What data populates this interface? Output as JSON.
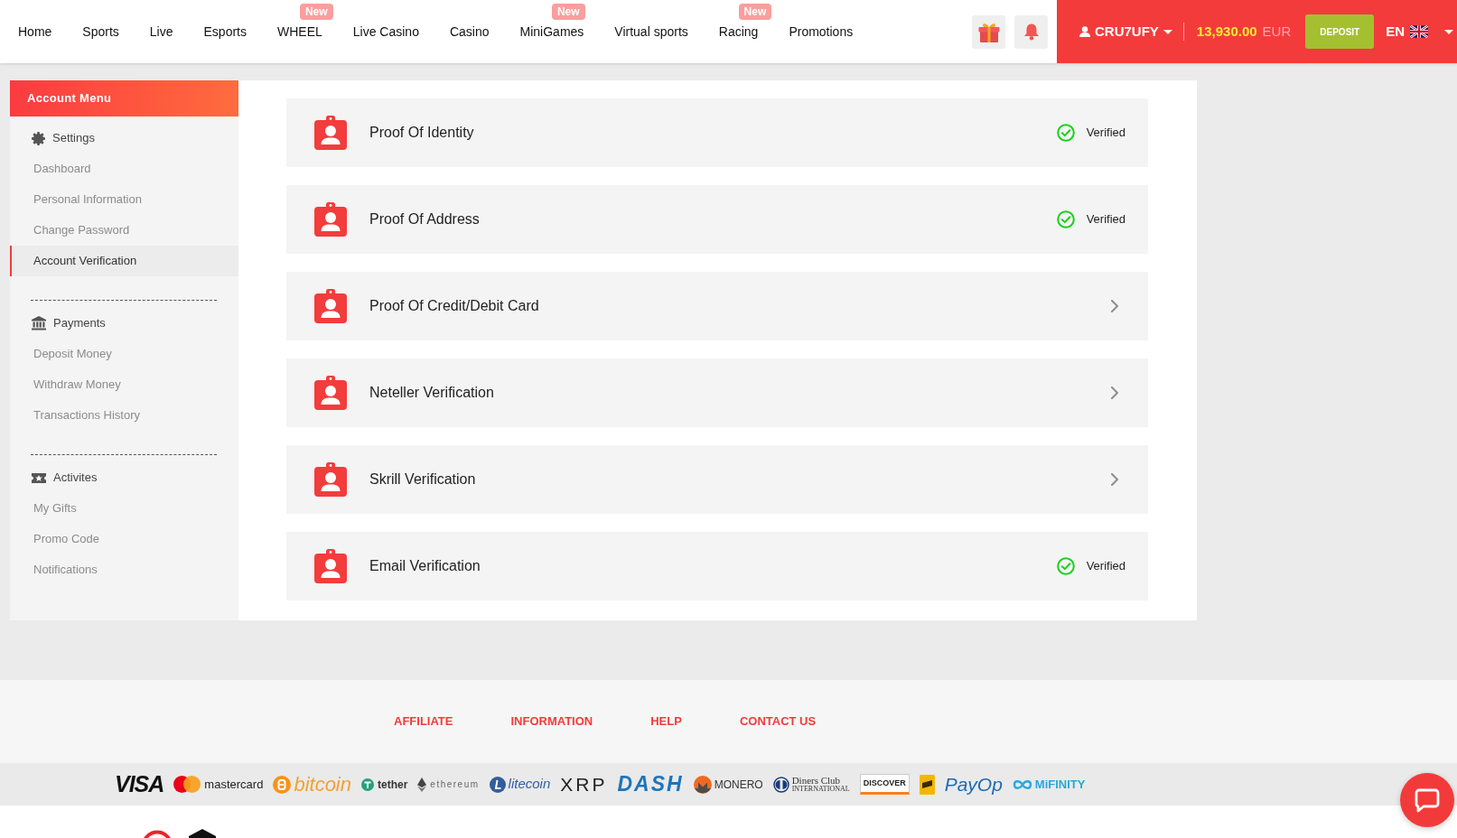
{
  "nav": {
    "items": [
      {
        "label": "Home"
      },
      {
        "label": "Sports"
      },
      {
        "label": "Live"
      },
      {
        "label": "Esports"
      },
      {
        "label": "WHEEL",
        "badge": "New"
      },
      {
        "label": "Live Casino"
      },
      {
        "label": "Casino"
      },
      {
        "label": "MiniGames",
        "badge": "New"
      },
      {
        "label": "Virtual sports"
      },
      {
        "label": "Racing",
        "badge": "New"
      },
      {
        "label": "Promotions"
      }
    ]
  },
  "account_bar": {
    "user": "CRU7UFY",
    "balance": "13,930.00",
    "currency": "EUR",
    "deposit_button": "DEPOSIT",
    "language": "EN"
  },
  "sidebar": {
    "title": "Account Menu",
    "groups": [
      {
        "title": "Settings",
        "items": [
          {
            "label": "Dashboard",
            "selected": false
          },
          {
            "label": "Personal Information",
            "selected": false
          },
          {
            "label": "Change Password",
            "selected": false
          },
          {
            "label": "Account Verification",
            "selected": true
          }
        ]
      },
      {
        "title": "Payments",
        "items": [
          {
            "label": "Deposit Money",
            "selected": false
          },
          {
            "label": "Withdraw Money",
            "selected": false
          },
          {
            "label": "Transactions History",
            "selected": false
          }
        ]
      },
      {
        "title": "Activites",
        "items": [
          {
            "label": "My Gifts",
            "selected": false
          },
          {
            "label": "Promo Code",
            "selected": false
          },
          {
            "label": "Notifications",
            "selected": false
          }
        ]
      }
    ]
  },
  "verifications": [
    {
      "title": "Proof Of Identity",
      "verified": true,
      "status": "Verified"
    },
    {
      "title": "Proof Of Address",
      "verified": true,
      "status": "Verified"
    },
    {
      "title": "Proof Of Credit/Debit Card",
      "verified": false
    },
    {
      "title": "Neteller Verification",
      "verified": false
    },
    {
      "title": "Skrill Verification",
      "verified": false
    },
    {
      "title": "Email Verification",
      "verified": true,
      "status": "Verified"
    }
  ],
  "footer": {
    "links": [
      "AFFILIATE",
      "INFORMATION",
      "HELP",
      "CONTACT US"
    ],
    "payment_methods": [
      {
        "kind": "visa",
        "label": "VISA"
      },
      {
        "kind": "mastercard",
        "label": "mastercard"
      },
      {
        "kind": "bitcoin",
        "label": "bitcoin"
      },
      {
        "kind": "tether",
        "label": "tether"
      },
      {
        "kind": "ethereum",
        "label": "ethereum"
      },
      {
        "kind": "litecoin",
        "label": "litecoin"
      },
      {
        "kind": "xrp",
        "label": "XRP"
      },
      {
        "kind": "dash",
        "label": "DASH"
      },
      {
        "kind": "monero",
        "label": "MONERO"
      },
      {
        "kind": "diners",
        "label": "Diners Club",
        "sublabel": "INTERNATIONAL"
      },
      {
        "kind": "discover",
        "label": "DISCOVER"
      },
      {
        "kind": "card"
      },
      {
        "kind": "payop",
        "label": "PayOp"
      },
      {
        "kind": "mifinity",
        "label": "MiFINITY"
      }
    ]
  }
}
